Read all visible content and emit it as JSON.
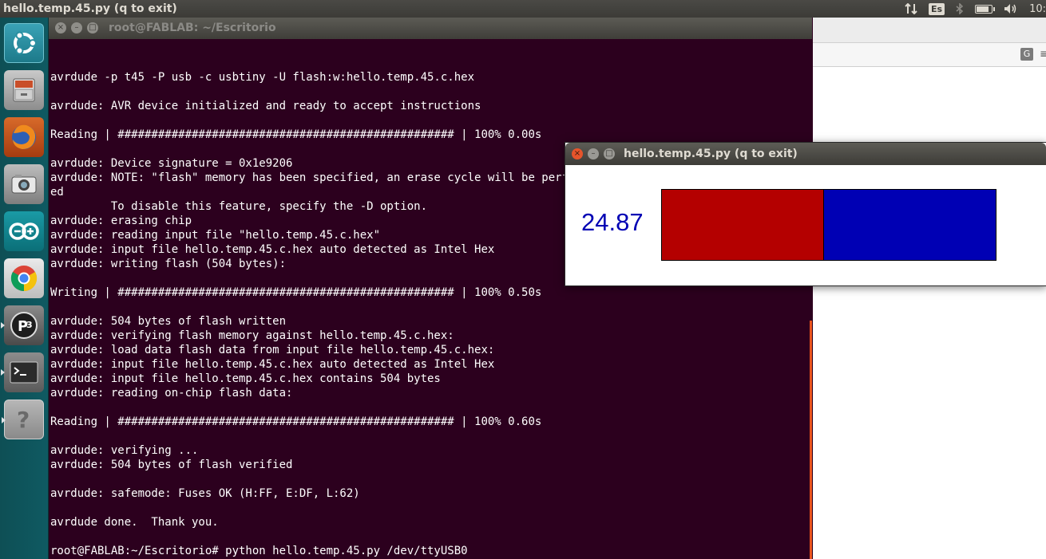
{
  "top_panel": {
    "app_title": "hello.temp.45.py (q to exit)",
    "keyboard_layout": "Es",
    "clock": "10:"
  },
  "launcher": {
    "items": [
      {
        "name": "ubuntu-dash",
        "icon": "ubuntu-logo-icon"
      },
      {
        "name": "files",
        "icon": "file-cabinet-icon"
      },
      {
        "name": "firefox",
        "icon": "firefox-icon"
      },
      {
        "name": "camera",
        "icon": "camera-icon"
      },
      {
        "name": "arduino",
        "icon": "arduino-icon"
      },
      {
        "name": "chrome",
        "icon": "chrome-icon"
      },
      {
        "name": "processing",
        "icon": "p3-icon"
      },
      {
        "name": "terminal",
        "icon": "terminal-icon"
      },
      {
        "name": "help",
        "icon": "help-icon"
      }
    ]
  },
  "terminal": {
    "title": "root@FABLAB: ~/Escritorio",
    "output": "avrdude -p t45 -P usb -c usbtiny -U flash:w:hello.temp.45.c.hex\n\navrdude: AVR device initialized and ready to accept instructions\n\nReading | ################################################## | 100% 0.00s\n\navrdude: Device signature = 0x1e9206\navrdude: NOTE: \"flash\" memory has been specified, an erase cycle will be perform\ned\n         To disable this feature, specify the -D option.\navrdude: erasing chip\navrdude: reading input file \"hello.temp.45.c.hex\"\navrdude: input file hello.temp.45.c.hex auto detected as Intel Hex\navrdude: writing flash (504 bytes):\n\nWriting | ################################################## | 100% 0.50s\n\navrdude: 504 bytes of flash written\navrdude: verifying flash memory against hello.temp.45.c.hex:\navrdude: load data flash data from input file hello.temp.45.c.hex:\navrdude: input file hello.temp.45.c.hex auto detected as Intel Hex\navrdude: input file hello.temp.45.c.hex contains 504 bytes\navrdude: reading on-chip flash data:\n\nReading | ################################################## | 100% 0.60s\n\navrdude: verifying ...\navrdude: 504 bytes of flash verified\n\navrdude: safemode: Fuses OK (H:FF, E:DF, L:62)\n\navrdude done.  Thank you.\n\nroot@FABLAB:~/Escritorio# python hello.temp.45.py /dev/ttyUSB0"
  },
  "app_window": {
    "title": "hello.temp.45.py (q to exit)",
    "temperature": "24.87",
    "bar_fraction": 0.485,
    "colors": {
      "value_text": "#0000b4",
      "bar_fill": "#b40000",
      "bar_rest": "#0000b4"
    }
  },
  "window_buttons": {
    "close": "×",
    "minimize": "–",
    "maximize": "□"
  }
}
